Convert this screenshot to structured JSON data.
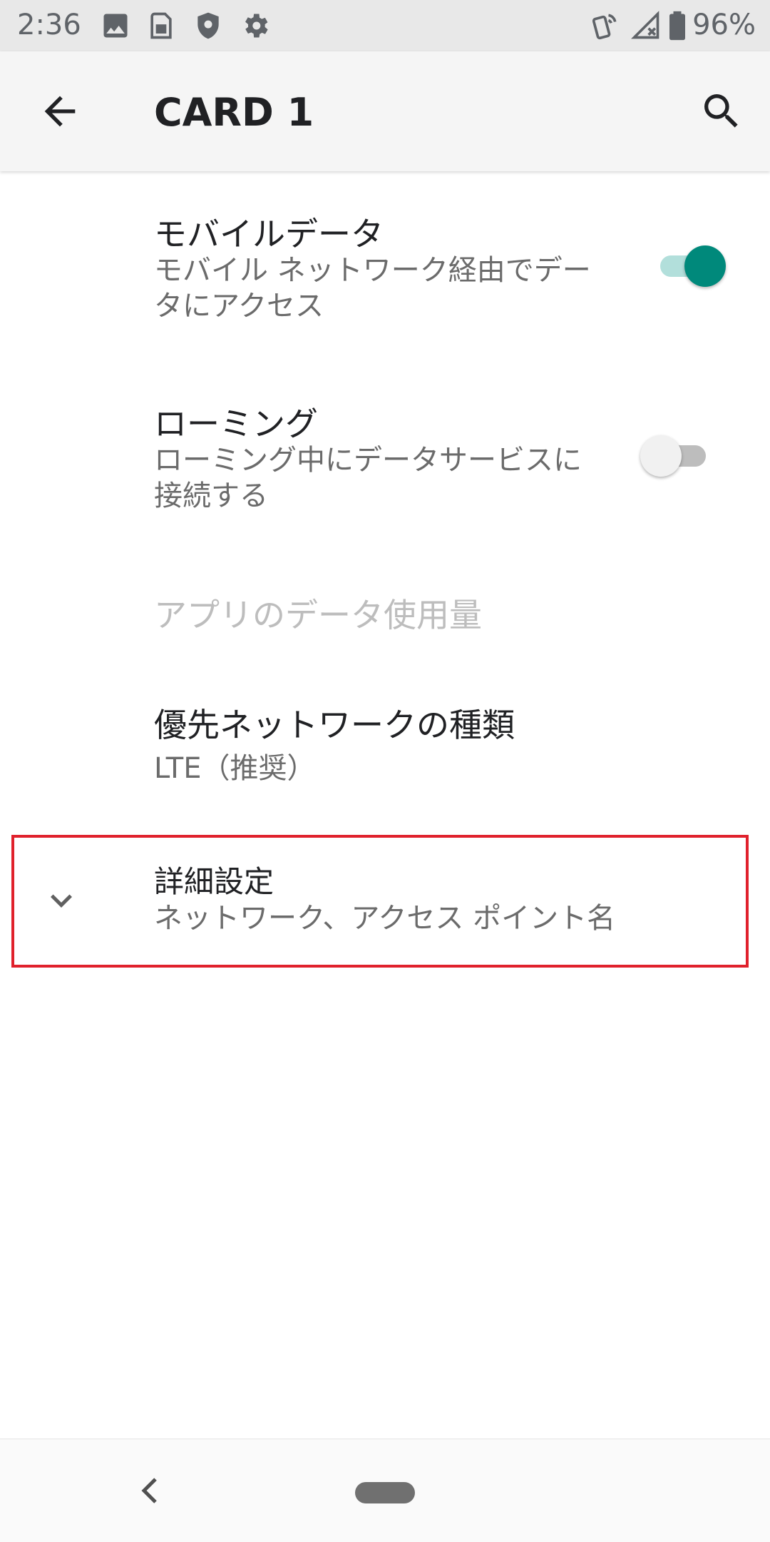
{
  "status_bar": {
    "time": "2:36",
    "battery": "96%",
    "icons": [
      "image-icon",
      "sim-card-icon",
      "shield-icon",
      "settings-gear-icon",
      "vibrate-nfc-icon",
      "no-signal-icon",
      "battery-icon"
    ]
  },
  "app_bar": {
    "title": "CARD 1",
    "back_icon": "arrow-back-icon",
    "search_icon": "search-icon"
  },
  "preferences": [
    {
      "title": "モバイルデータ",
      "summary": "モバイル ネットワーク経由でデータにアクセス",
      "switch": true
    },
    {
      "title": "ローミング",
      "summary": "ローミング中にデータサービスに接続する",
      "switch": false
    },
    {
      "title": "アプリのデータ使用量",
      "enabled": false
    },
    {
      "title": "優先ネットワークの種類",
      "summary": "LTE（推奨）"
    },
    {
      "title": "詳細設定",
      "summary": "ネットワーク、アクセス ポイント名",
      "icon": "chevron-down-icon",
      "highlighted": true
    }
  ],
  "colors": {
    "accent": "#00897b",
    "accent_track": "#b2dfdb",
    "switch_off_thumb": "#f1f1f1",
    "switch_off_track": "#bdbdbd",
    "highlight": "#e0212c"
  },
  "nav_bar": {
    "back_icon": "nav-back-icon",
    "home_icon": "nav-home-pill-icon"
  }
}
